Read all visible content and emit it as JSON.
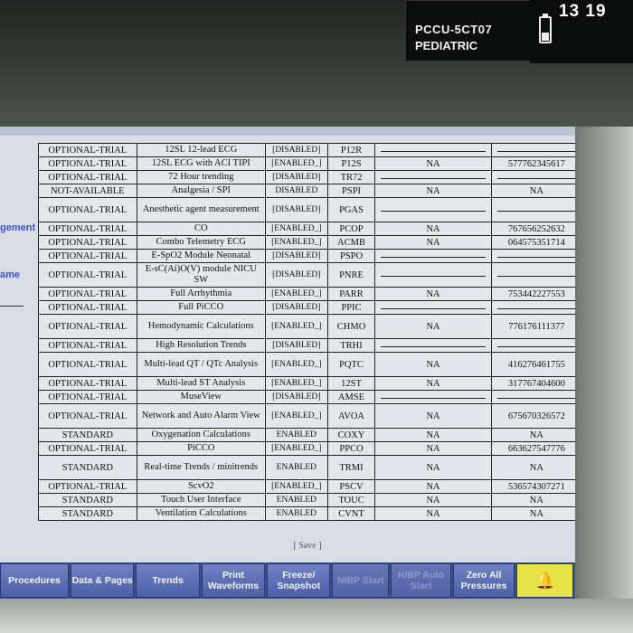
{
  "status": {
    "unit": "PCCU-5CT07",
    "patient_type": "PEDIATRIC",
    "time": "13 19",
    "battery_icon": "battery-icon"
  },
  "left_panel": {
    "label_1": "gement",
    "label_2": "ame"
  },
  "table": {
    "rows": [
      {
        "status": "OPTIONAL-TRIAL",
        "feature": "12SL 12-lead ECG",
        "state": "[DISABLED]",
        "code": "P12R",
        "na": "",
        "key": "",
        "tall": false
      },
      {
        "status": "OPTIONAL-TRIAL",
        "feature": "12SL ECG with ACI TIPI",
        "state": "[ENABLED_]",
        "code": "P12S",
        "na": "NA",
        "key": "577762345617",
        "tall": false
      },
      {
        "status": "OPTIONAL-TRIAL",
        "feature": "72 Hour trending",
        "state": "[DISABLED]",
        "code": "TR72",
        "na": "",
        "key": "",
        "tall": false
      },
      {
        "status": "NOT-AVAILABLE",
        "feature": "Analgesia / SPI",
        "state": "DISABLED",
        "code": "PSPI",
        "na": "NA",
        "key": "NA",
        "tall": false
      },
      {
        "status": "OPTIONAL-TRIAL",
        "feature": "Anesthetic agent measurement",
        "state": "[DISABLED]",
        "code": "PGAS",
        "na": "",
        "key": "",
        "tall": true
      },
      {
        "status": "OPTIONAL-TRIAL",
        "feature": "CO",
        "state": "[ENABLED_]",
        "code": "PCOP",
        "na": "NA",
        "key": "767656252632",
        "tall": false
      },
      {
        "status": "OPTIONAL-TRIAL",
        "feature": "Combo Telemetry ECG",
        "state": "[ENABLED_]",
        "code": "ACMB",
        "na": "NA",
        "key": "064575351714",
        "tall": false
      },
      {
        "status": "OPTIONAL-TRIAL",
        "feature": "E-SpO2 Module Neonatal",
        "state": "[DISABLED]",
        "code": "PSPO",
        "na": "",
        "key": "",
        "tall": false
      },
      {
        "status": "OPTIONAL-TRIAL",
        "feature": "E-sC(Ai)O(V) module NICU SW",
        "state": "[DISABLED]",
        "code": "PNRE",
        "na": "",
        "key": "",
        "tall": true
      },
      {
        "status": "OPTIONAL-TRIAL",
        "feature": "Full Arrhythmia",
        "state": "[ENABLED_]",
        "code": "PARR",
        "na": "NA",
        "key": "753442227553",
        "tall": false
      },
      {
        "status": "OPTIONAL-TRIAL",
        "feature": "Full PiCCO",
        "state": "[DISABLED]",
        "code": "PPIC",
        "na": "",
        "key": "",
        "tall": false
      },
      {
        "status": "OPTIONAL-TRIAL",
        "feature": "Hemodynamic Calculations",
        "state": "[ENABLED_]",
        "code": "CHMO",
        "na": "NA",
        "key": "776176111377",
        "tall": true
      },
      {
        "status": "OPTIONAL-TRIAL",
        "feature": "High Resolution Trends",
        "state": "[DISABLED]",
        "code": "TRHI",
        "na": "",
        "key": "",
        "tall": false
      },
      {
        "status": "OPTIONAL-TRIAL",
        "feature": "Multi-lead QT / QTc Analysis",
        "state": "[ENABLED_]",
        "code": "PQTC",
        "na": "NA",
        "key": "416276461755",
        "tall": true
      },
      {
        "status": "OPTIONAL-TRIAL",
        "feature": "Multi-lead ST Analysis",
        "state": "[ENABLED_]",
        "code": "12ST",
        "na": "NA",
        "key": "317767404600",
        "tall": false
      },
      {
        "status": "OPTIONAL-TRIAL",
        "feature": "MuseView",
        "state": "[DISABLED]",
        "code": "AMSE",
        "na": "",
        "key": "",
        "tall": false
      },
      {
        "status": "OPTIONAL-TRIAL",
        "feature": "Network and Auto Alarm View",
        "state": "[ENABLED_]",
        "code": "AVOA",
        "na": "NA",
        "key": "675670326572",
        "tall": true
      },
      {
        "status": "STANDARD",
        "feature": "Oxygenation Calculations",
        "state": "ENABLED",
        "code": "COXY",
        "na": "NA",
        "key": "NA",
        "tall": false
      },
      {
        "status": "OPTIONAL-TRIAL",
        "feature": "PiCCO",
        "state": "[ENABLED_]",
        "code": "PPCO",
        "na": "NA",
        "key": "663627547776",
        "tall": false
      },
      {
        "status": "STANDARD",
        "feature": "Real-time Trends / minitrends",
        "state": "ENABLED",
        "code": "TRMI",
        "na": "NA",
        "key": "NA",
        "tall": true
      },
      {
        "status": "OPTIONAL-TRIAL",
        "feature": "ScvO2",
        "state": "[ENABLED_]",
        "code": "PSCV",
        "na": "NA",
        "key": "536574307271",
        "tall": false
      },
      {
        "status": "STANDARD",
        "feature": "Touch User Interface",
        "state": "ENABLED",
        "code": "TOUC",
        "na": "NA",
        "key": "NA",
        "tall": false
      },
      {
        "status": "STANDARD",
        "feature": "Ventilation Calculations",
        "state": "ENABLED",
        "code": "CVNT",
        "na": "NA",
        "key": "NA",
        "tall": false
      }
    ]
  },
  "save_label": "[ Save ]",
  "toolbar": [
    {
      "label": "Procedures",
      "width": 80,
      "disabled": false
    },
    {
      "label": "Data & Pages",
      "width": 74,
      "disabled": false
    },
    {
      "label": "Trends",
      "width": 74,
      "disabled": false
    },
    {
      "label": "Print Waveforms",
      "width": 74,
      "disabled": false
    },
    {
      "label": "Freeze/ Snapshot",
      "width": 74,
      "disabled": false
    },
    {
      "label": "NIBP Start",
      "width": 66,
      "disabled": true
    },
    {
      "label": "NIBP Auto Start",
      "width": 70,
      "disabled": true
    },
    {
      "label": "Zero All Pressures",
      "width": 72,
      "disabled": false
    }
  ],
  "alarm_icon": "alarm-bell-icon",
  "colors": {
    "toolbar": "#4d5fa5",
    "alarm": "#e7e34a",
    "side_label": "#3b55c7"
  }
}
